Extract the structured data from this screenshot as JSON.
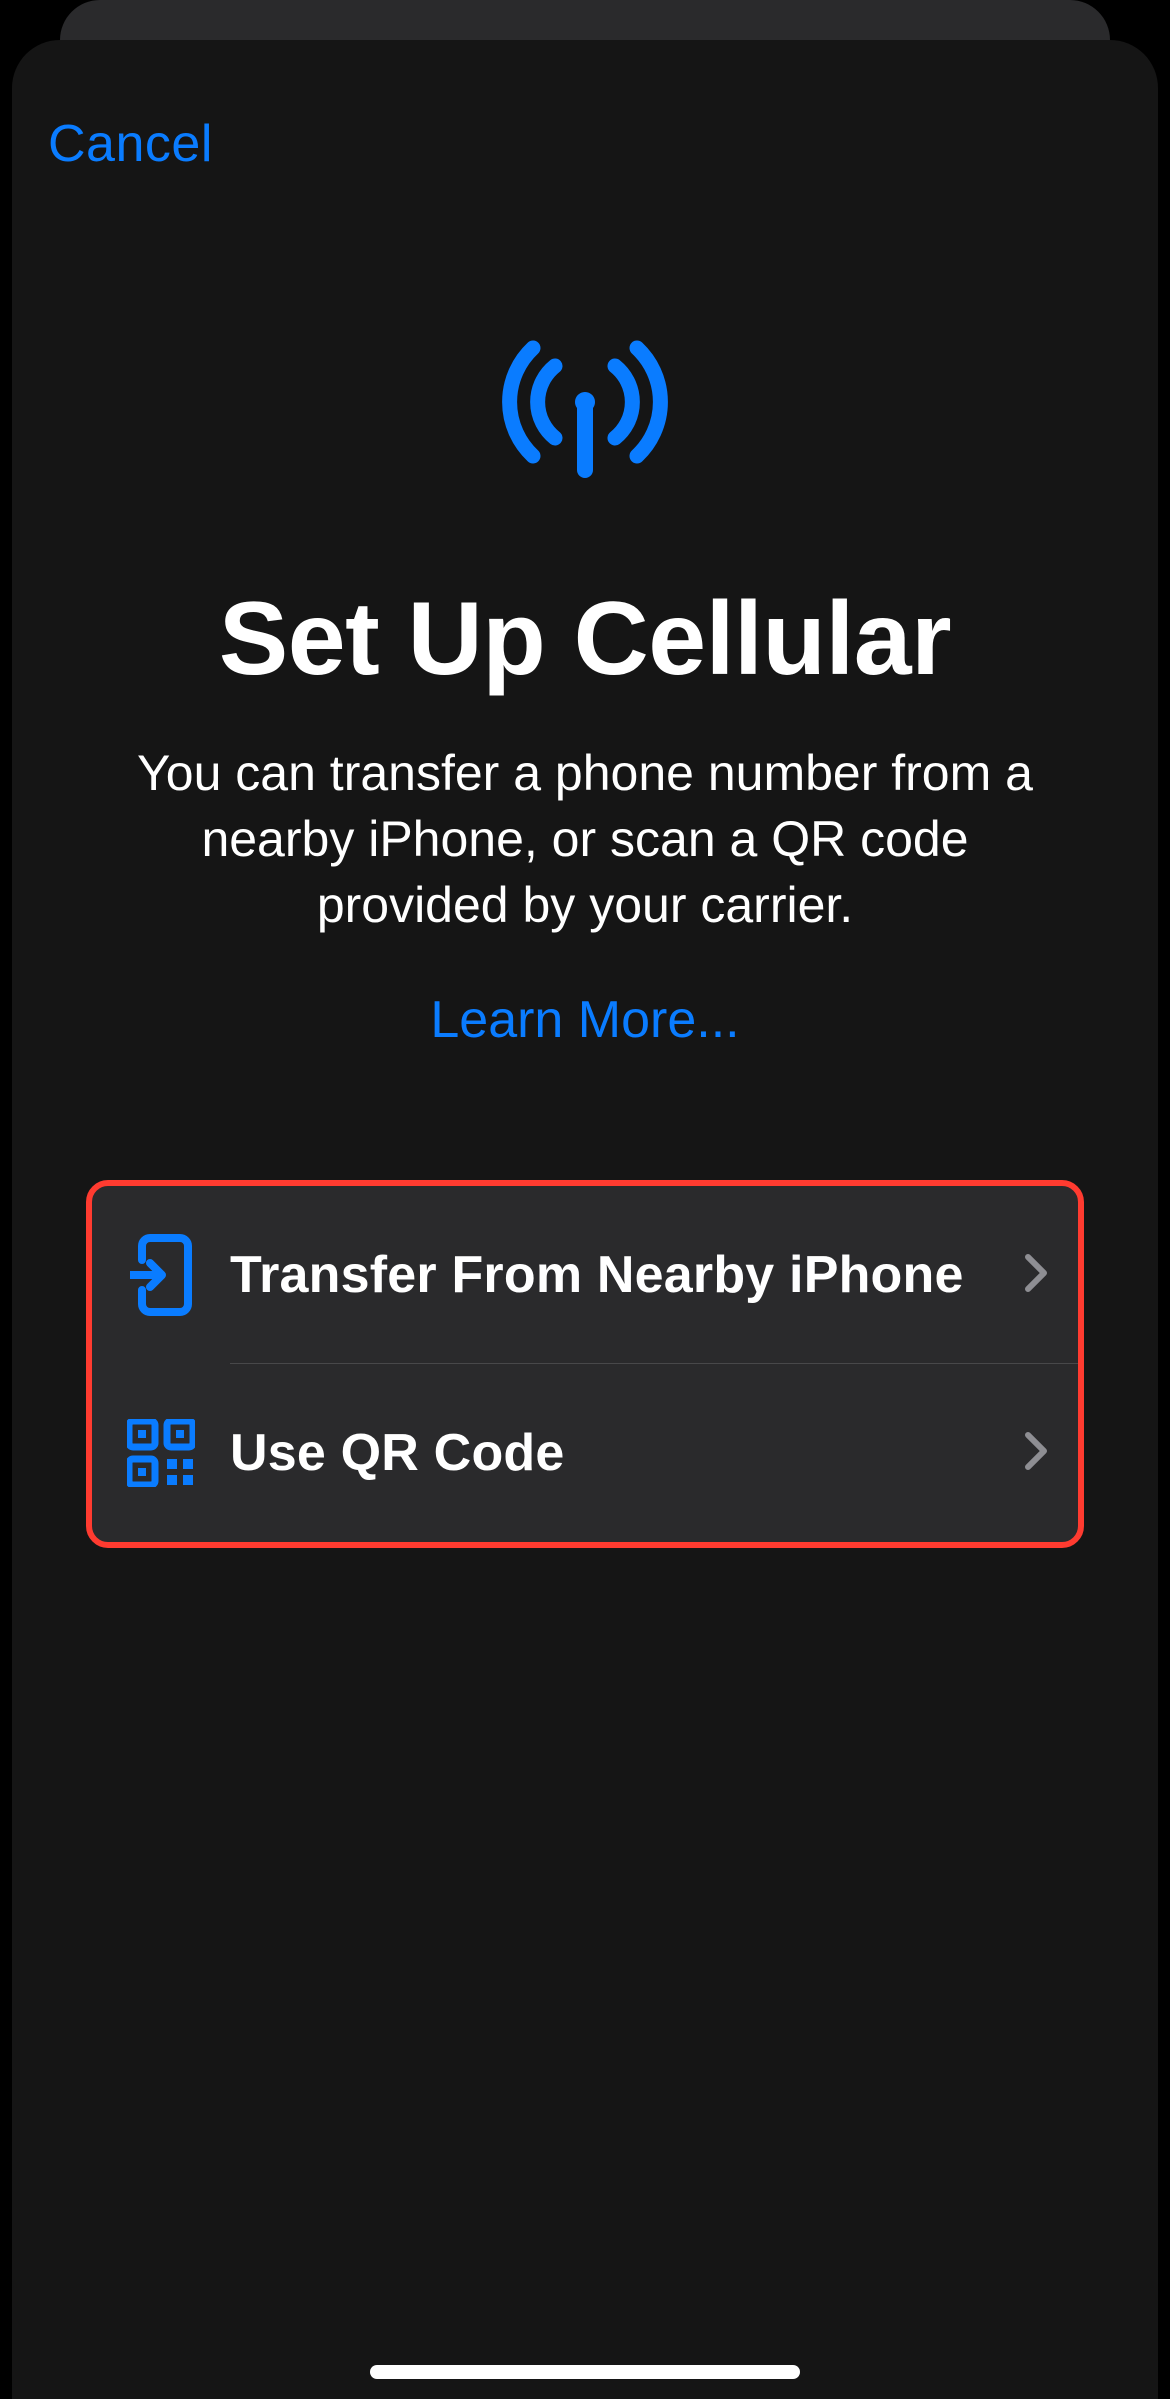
{
  "nav": {
    "cancel": "Cancel"
  },
  "hero": {
    "title": "Set Up Cellular",
    "subtitle": "You can transfer a phone number from a nearby iPhone, or scan a QR code provided by your carrier.",
    "learn_more": "Learn More..."
  },
  "options": [
    {
      "label": "Transfer From Nearby iPhone"
    },
    {
      "label": "Use QR Code"
    }
  ]
}
